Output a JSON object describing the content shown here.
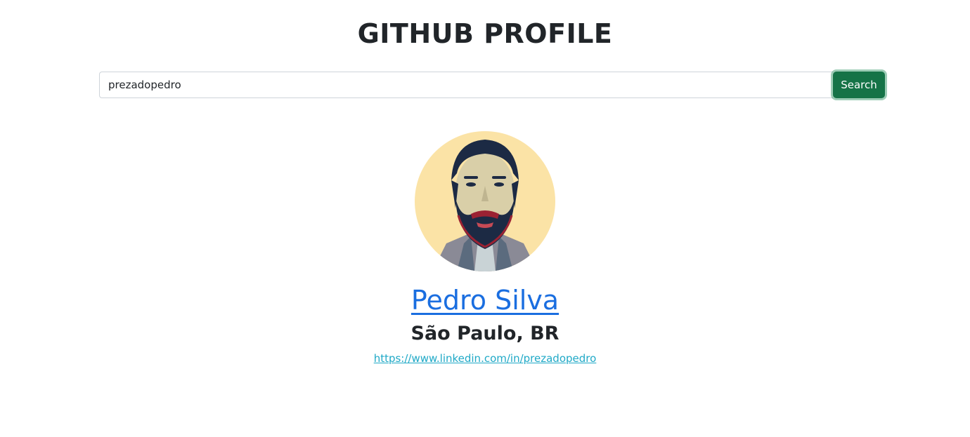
{
  "header": {
    "title": "GITHUB PROFILE"
  },
  "search": {
    "value": "prezadopedro",
    "button_label": "Search"
  },
  "profile": {
    "name": "Pedro Silva",
    "location": "São Paulo, BR",
    "blog_url": "https://www.linkedin.com/in/prezadopedro",
    "avatar_icon": "avatar-portrait-icon"
  },
  "colors": {
    "accent_button": "#157347",
    "name_link": "#1a6ee0",
    "blog_link": "#1fa9c7",
    "avatar_background": "#fbe3a6"
  }
}
